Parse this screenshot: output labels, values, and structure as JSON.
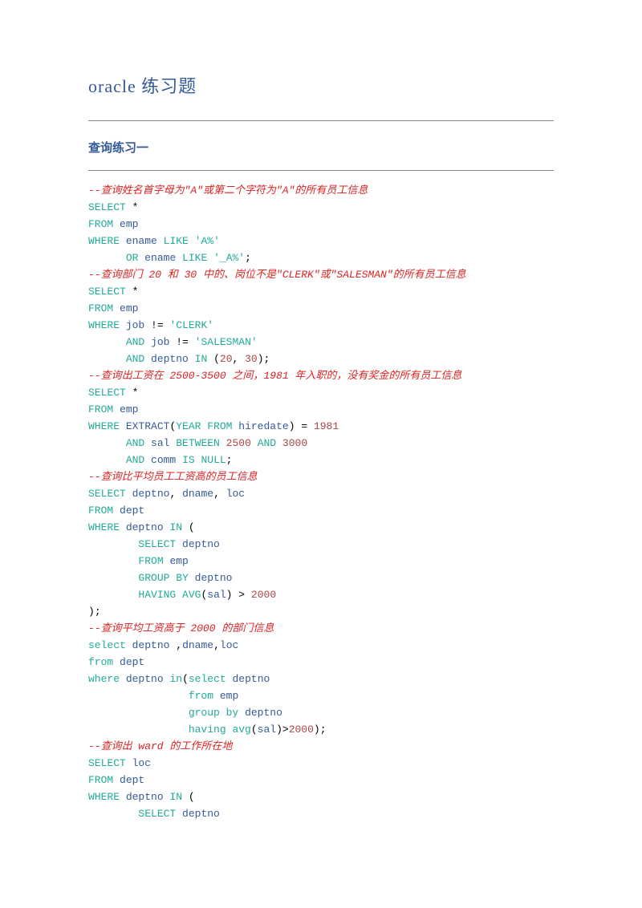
{
  "doc": {
    "title": "oracle 练习题",
    "subtitle": "查询练习一"
  },
  "code": {
    "c1": "--查询姓名首字母为\"A\"或第二个字符为\"A\"的所有员工信息",
    "l1a": "SELECT",
    "l1b": "*",
    "l2a": "FROM",
    "l2b": "emp",
    "l3a": "WHERE",
    "l3b": "ename",
    "l3c": "LIKE",
    "l3d": "'A%'",
    "l4a": "OR",
    "l4b": "ename",
    "l4c": "LIKE",
    "l4d": "'_A%'",
    "l4e": ";",
    "c2": "--查询部门 20 和 30 中的、岗位不是\"CLERK\"或\"SALESMAN\"的所有员工信息",
    "l5a": "SELECT",
    "l5b": "*",
    "l6a": "FROM",
    "l6b": "emp",
    "l7a": "WHERE",
    "l7b": "job",
    "l7c": "!=",
    "l7d": "'CLERK'",
    "l8a": "AND",
    "l8b": "job",
    "l8c": "!=",
    "l8d": "'SALESMAN'",
    "l9a": "AND",
    "l9b": "deptno",
    "l9c": "IN",
    "l9d": "(",
    "l9e": "20",
    "l9f": ",",
    "l9g": "30",
    "l9h": ")",
    "l9i": ";",
    "c3": "--查询出工资在 2500-3500 之间，1981 年入职的，没有奖金的所有员工信息",
    "l10a": "SELECT",
    "l10b": "*",
    "l11a": "FROM",
    "l11b": "emp",
    "l12a": "WHERE",
    "l12b": "EXTRACT",
    "l12c": "(",
    "l12d": "YEAR FROM",
    "l12e": "hiredate",
    "l12f": ")",
    "l12g": "=",
    "l12h": "1981",
    "l13a": "AND",
    "l13b": "sal",
    "l13c": "BETWEEN",
    "l13d": "2500",
    "l13e": "AND",
    "l13f": "3000",
    "l14a": "AND",
    "l14b": "comm",
    "l14c": "IS NULL",
    "l14d": ";",
    "c4": "--查询比平均员工工资高的员工信息",
    "l15a": "SELECT",
    "l15b": "deptno",
    "l15c": ",",
    "l15d": "dname",
    "l15e": ",",
    "l15f": "loc",
    "l16a": "FROM",
    "l16b": "dept",
    "l17a": "WHERE",
    "l17b": "deptno",
    "l17c": "IN",
    "l17d": "(",
    "l18a": "SELECT",
    "l18b": "deptno",
    "l19a": "FROM",
    "l19b": "emp",
    "l20a": "GROUP BY",
    "l20b": "deptno",
    "l21a": "HAVING",
    "l21b": "AVG",
    "l21c": "(",
    "l21d": "sal",
    "l21e": ")",
    "l21f": ">",
    "l21g": "2000",
    "l22a": ")",
    "l22b": ";",
    "c5": "--查询平均工资高于 2000 的部门信息",
    "l23a": "select",
    "l23b": "deptno",
    "l23c": ",",
    "l23d": "dname",
    "l23e": ",",
    "l23f": "loc",
    "l24a": "from",
    "l24b": "dept",
    "l25a": "where",
    "l25b": "deptno",
    "l25c": "in",
    "l25d": "(",
    "l25e": "select",
    "l25f": "deptno",
    "l26a": "from",
    "l26b": "emp",
    "l27a": "group by",
    "l27b": "deptno",
    "l28a": "having",
    "l28b": "avg",
    "l28c": "(",
    "l28d": "sal",
    "l28e": ")",
    "l28f": ">",
    "l28g": "2000",
    "l28h": ")",
    "l28i": ";",
    "c6": "--查询出 ward 的工作所在地",
    "l29a": "SELECT",
    "l29b": "loc",
    "l30a": "FROM",
    "l30b": "dept",
    "l31a": "WHERE",
    "l31b": "deptno",
    "l31c": "IN",
    "l31d": "(",
    "l32a": "SELECT",
    "l32b": "deptno"
  }
}
